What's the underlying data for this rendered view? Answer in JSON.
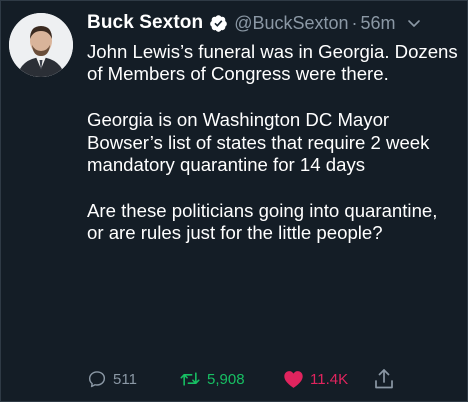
{
  "tweet": {
    "author_name": "Buck Sexton",
    "handle": "@BuckSexton",
    "separator": "·",
    "time": "56m",
    "paragraphs": [
      "John Lewis’s funeral was in Georgia. Dozens of Members of Congress were there.",
      "Georgia is on Washington DC Mayor Bowser’s list of states that require 2 week mandatory quarantine for 14 days",
      "Are these politicians going into quarantine, or are rules just for the little people?"
    ],
    "actions": {
      "reply_count": "511",
      "retweet_count": "5,908",
      "like_count": "11.4K"
    }
  },
  "icons": {
    "verified": "verified-badge-icon",
    "more": "chevron-down-icon",
    "reply": "reply-icon",
    "retweet": "retweet-icon",
    "like": "heart-icon",
    "share": "share-icon"
  },
  "colors": {
    "background": "#15202b",
    "text": "#ffffff",
    "secondary_text": "#8b98a5",
    "retweet_green": "#17bf63",
    "like_red": "#e0245e"
  }
}
